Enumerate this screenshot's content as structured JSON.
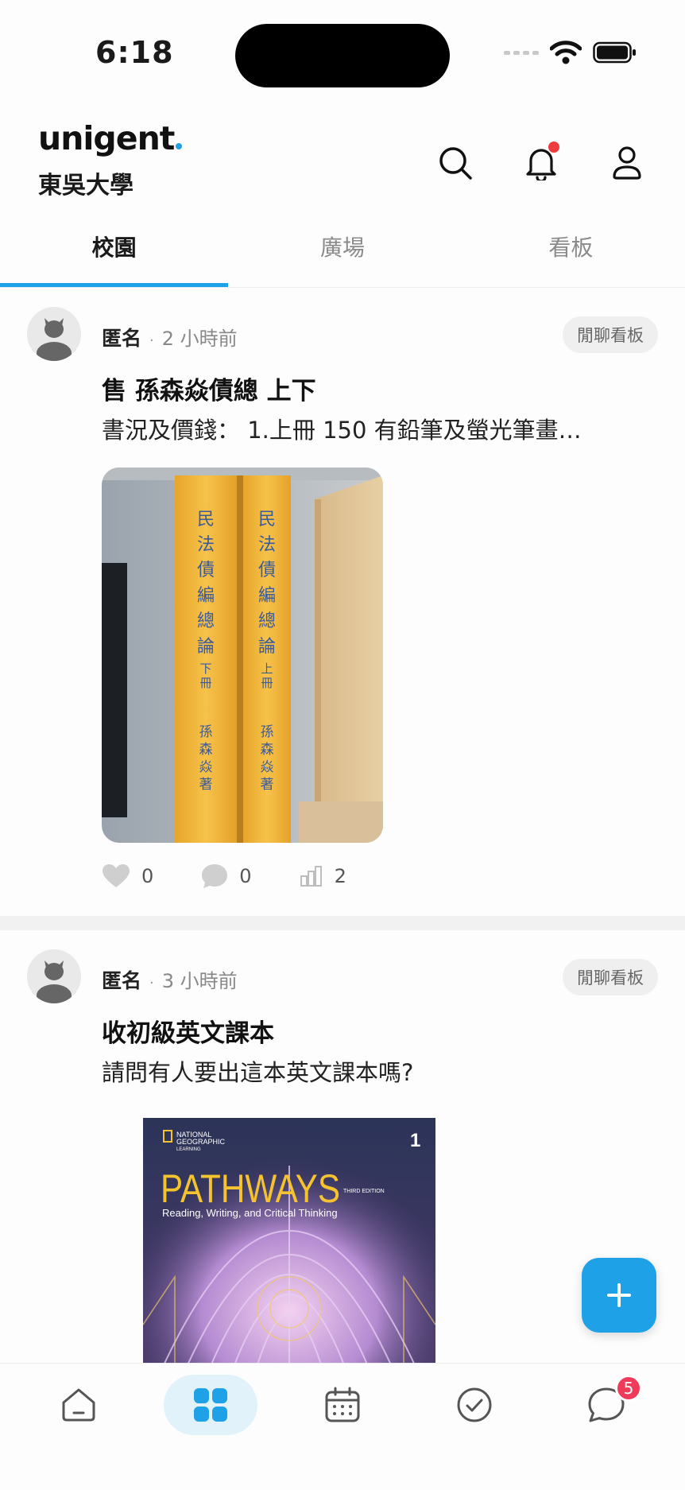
{
  "status_bar": {
    "time": "6:18"
  },
  "header": {
    "logo": "unigent",
    "school": "東吳大學"
  },
  "tabs": [
    {
      "label": "校園",
      "active": true
    },
    {
      "label": "廣場",
      "active": false
    },
    {
      "label": "看板",
      "active": false
    }
  ],
  "posts": [
    {
      "author": "匿名",
      "time": "2 小時前",
      "board": "閒聊看板",
      "title": "售 孫森焱債總 上下",
      "body": "書況及價錢： 1.上冊 150 有鉛筆及螢光筆畫…",
      "image": {
        "book_left": {
          "spine_title": "民法債編總論",
          "volume": "下冊",
          "author": "孫森焱著"
        },
        "book_right": {
          "spine_title": "民法債編總論",
          "volume": "上冊",
          "author": "孫森焱著"
        }
      },
      "stats": {
        "likes": "0",
        "comments": "0",
        "views": "2"
      }
    },
    {
      "author": "匿名",
      "time": "3 小時前",
      "board": "閒聊看板",
      "title": "收初級英文課本",
      "body": "請問有人要出這本英文課本嗎?",
      "image": {
        "publisher_line1": "NATIONAL",
        "publisher_line2": "GEOGRAPHIC",
        "publisher_line3": "LEARNING",
        "book_title": "PATHWAYS",
        "edition": "THIRD EDITION",
        "subtitle": "Reading, Writing, and Critical Thinking",
        "level": "1"
      }
    }
  ],
  "bottom_nav": {
    "items": [
      {
        "icon": "home-icon",
        "active": false
      },
      {
        "icon": "grid-icon",
        "active": true
      },
      {
        "icon": "calendar-icon",
        "active": false
      },
      {
        "icon": "check-circle-icon",
        "active": false
      },
      {
        "icon": "chat-icon",
        "active": false,
        "badge": "5"
      }
    ]
  },
  "colors": {
    "accent": "#1ea1e6",
    "badge": "#ef3b5a",
    "notification_dot": "#ef3b3b"
  }
}
